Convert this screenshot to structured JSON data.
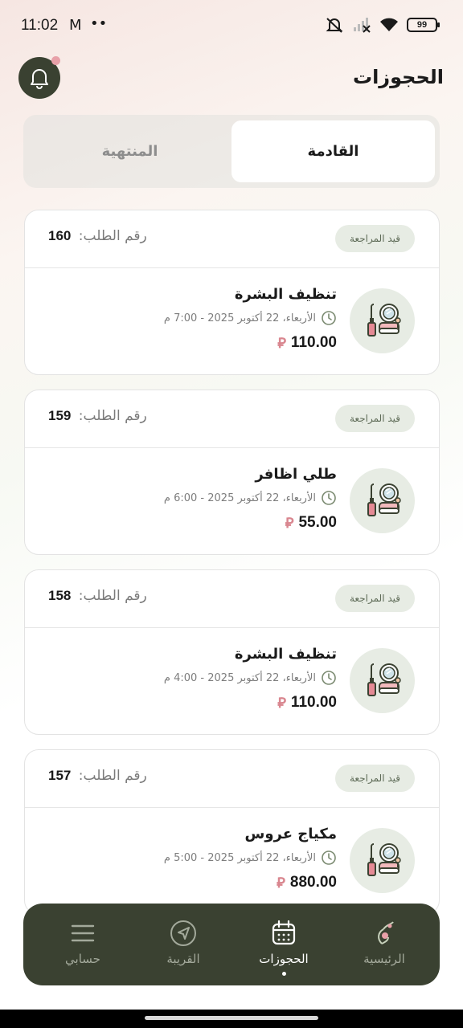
{
  "status_bar": {
    "time": "11:02",
    "mail_icon": "M",
    "dots": "••",
    "battery": "99"
  },
  "header": {
    "title": "الحجوزات",
    "notification_icon": "bell-icon"
  },
  "tabs": [
    {
      "label": "القادمة",
      "active": true
    },
    {
      "label": "المنتهية",
      "active": false
    }
  ],
  "bookings": [
    {
      "order_label": "رقم الطلب:",
      "order_number": "160",
      "status": "قيد المراجعة",
      "service": "تنظيف البشرة",
      "date": "الأربعاء، 22 أكتوبر 2025 - 7:00 م",
      "price": "110.00"
    },
    {
      "order_label": "رقم الطلب:",
      "order_number": "159",
      "status": "قيد المراجعة",
      "service": "طلي اظافر",
      "date": "الأربعاء، 22 أكتوبر 2025 - 6:00 م",
      "price": "55.00"
    },
    {
      "order_label": "رقم الطلب:",
      "order_number": "158",
      "status": "قيد المراجعة",
      "service": "تنظيف البشرة",
      "date": "الأربعاء، 22 أكتوبر 2025 - 4:00 م",
      "price": "110.00"
    },
    {
      "order_label": "رقم الطلب:",
      "order_number": "157",
      "status": "قيد المراجعة",
      "service": "مكياج عروس",
      "date": "الأربعاء، 22 أكتوبر 2025 - 5:00 م",
      "price": "880.00"
    }
  ],
  "currency_symbol": "⃁",
  "bottom_nav": [
    {
      "label": "الرئيسية",
      "icon": "home-logo-icon"
    },
    {
      "label": "الحجوزات",
      "icon": "calendar-icon",
      "active": true
    },
    {
      "label": "القريبة",
      "icon": "navigation-icon"
    },
    {
      "label": "حسابي",
      "icon": "menu-icon"
    }
  ],
  "colors": {
    "primary": "#3a4131",
    "badge_bg": "#e7ece4",
    "currency": "#d9868f",
    "notification_dot": "#e8a0a8"
  }
}
